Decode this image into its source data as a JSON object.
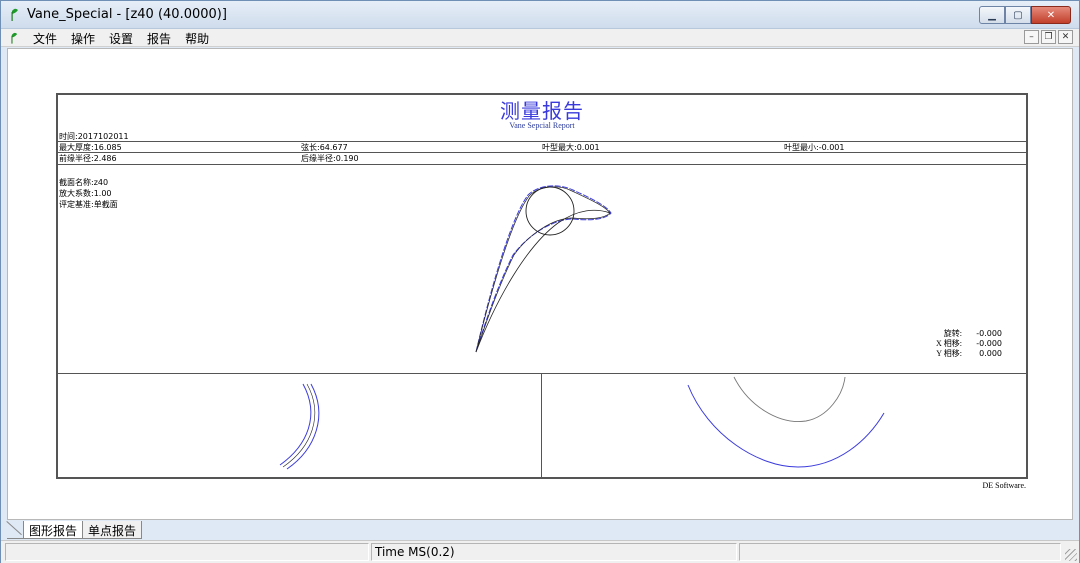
{
  "window": {
    "title": "Vane_Special - [z40    (40.0000)]"
  },
  "menu": {
    "items": [
      "文件",
      "操作",
      "设置",
      "报告",
      "帮助"
    ]
  },
  "report": {
    "title": "测量报告",
    "subtitle": "Vane Sepcial Report",
    "time": "时间:2017102011",
    "stats_row1": [
      "最大厚度:16.085",
      "弦长:64.677",
      "叶型最大:0.001",
      "叶型最小:-0.001"
    ],
    "stats_row2": [
      "前缘半径:2.486",
      "后缘半径:0.190"
    ],
    "section_info": [
      "截面名称:z40",
      "放大系数:1.00",
      "评定基准:单截面"
    ],
    "transform": [
      {
        "label": "旋转:",
        "value": "-0.000"
      },
      {
        "label": "X 相移:",
        "value": "-0.000"
      },
      {
        "label": "Y 相移:",
        "value": "0.000"
      }
    ],
    "footer": "DE Software."
  },
  "tabs": [
    "图形报告",
    "单点报告"
  ],
  "status": {
    "time": "Time MS(0.2)"
  },
  "colors": {
    "measured": "#3b3bdc",
    "nominal": "#222222",
    "title": "#3a3adc"
  }
}
